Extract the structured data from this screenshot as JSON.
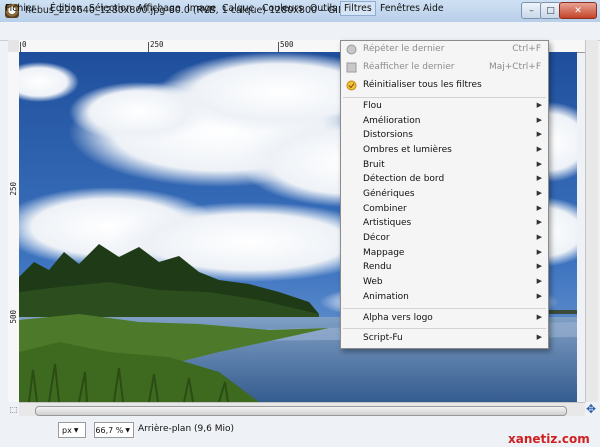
{
  "window": {
    "title": "hebus_221640_1280x800.jpg-60.0 (RVB, 1 calque) 1280x800 – GIMP",
    "controls": [
      "–",
      "□",
      "✕"
    ]
  },
  "menubar": [
    {
      "label": "Fichier"
    },
    {
      "label": "Édition"
    },
    {
      "label": "Sélection"
    },
    {
      "label": "Affichage"
    },
    {
      "label": "Image"
    },
    {
      "label": "Calque"
    },
    {
      "label": "Couleurs"
    },
    {
      "label": "Outils"
    },
    {
      "label": "Filtres",
      "active": true
    },
    {
      "label": "Fenêtres"
    },
    {
      "label": "Aide"
    }
  ],
  "rulers": {
    "top_labels": [
      "0",
      "250",
      "500"
    ],
    "left_labels": [
      "250",
      "500"
    ]
  },
  "filters_menu": {
    "top_items": [
      {
        "label": "Répéter le dernier",
        "shortcut": "Ctrl+F",
        "disabled": true,
        "icon": "repeat-icon"
      },
      {
        "label": "Réafficher le dernier",
        "shortcut": "Maj+Ctrl+F",
        "disabled": true,
        "icon": "reshow-icon"
      },
      {
        "label": "Réinitialiser tous les filtres",
        "shortcut": "",
        "disabled": false,
        "icon": "reset-icon"
      }
    ],
    "submenus": [
      "Flou",
      "Amélioration",
      "Distorsions",
      "Ombres et lumières",
      "Bruit",
      "Détection de bord",
      "Génériques",
      "Combiner",
      "Artistiques",
      "Décor",
      "Mappage",
      "Rendu",
      "Web",
      "Animation"
    ],
    "bottom_items": [
      "Alpha vers logo",
      "Script-Fu"
    ]
  },
  "statusbar": {
    "unit": "px",
    "zoom": "66,7 %",
    "layer_info": "Arrière-plan (9,6 Mio)"
  },
  "watermark": "xanetiz.com",
  "colors": {
    "sky": "#2a5ea8",
    "menu_highlight": "#d6e5f5",
    "watermark": "#d02020"
  }
}
